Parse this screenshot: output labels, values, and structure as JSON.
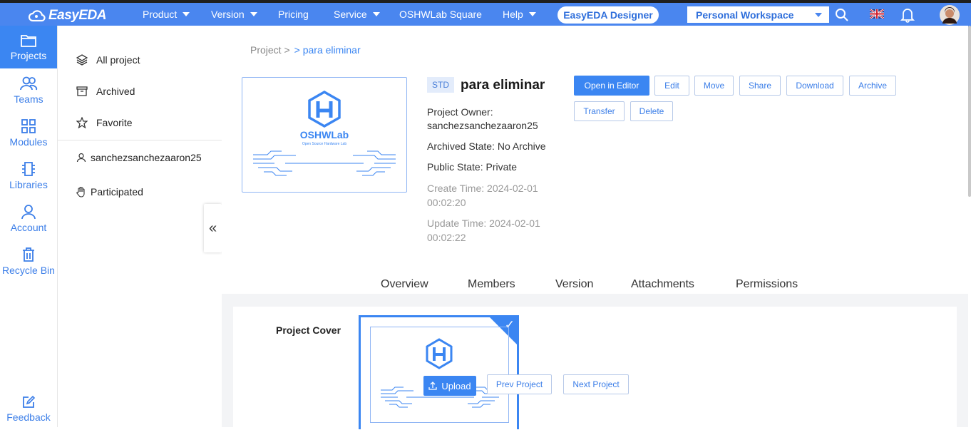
{
  "topbar": {
    "logo": "EasyEDA",
    "nav": [
      {
        "label": "Product",
        "dropdown": true
      },
      {
        "label": "Version",
        "dropdown": true
      },
      {
        "label": "Pricing",
        "dropdown": false
      },
      {
        "label": "Service",
        "dropdown": true
      },
      {
        "label": "OSHWLab Square",
        "dropdown": false
      },
      {
        "label": "Help",
        "dropdown": true
      }
    ],
    "designer_button": "EasyEDA Designer",
    "workspace": "Personal Workspace"
  },
  "leftbar": {
    "items": [
      {
        "label": "Projects",
        "icon": "folder-icon",
        "active": true
      },
      {
        "label": "Teams",
        "icon": "team-icon"
      },
      {
        "label": "Modules",
        "icon": "modules-icon"
      },
      {
        "label": "Libraries",
        "icon": "chip-icon"
      },
      {
        "label": "Account",
        "icon": "user-icon"
      },
      {
        "label": "Recycle Bin",
        "icon": "trash-icon"
      }
    ],
    "feedback": "Feedback"
  },
  "side2": {
    "items": [
      {
        "label": "All project",
        "icon": "layers-icon"
      },
      {
        "label": "Archived",
        "icon": "archive-icon"
      },
      {
        "label": "Favorite",
        "icon": "star-icon"
      }
    ],
    "user": "sanchezsanchezaaron25",
    "participated": "Participated"
  },
  "breadcrumb": {
    "root": "Project >",
    "current": "> para eliminar"
  },
  "project": {
    "badge": "STD",
    "title": "para eliminar",
    "owner_label": "Project Owner:",
    "owner": "sanchezsanchezaaron25",
    "archived_line": "Archived State:  No Archive",
    "public_line": "Public State:  Private",
    "create_line1": "Create Time:  2024-02-01",
    "create_line2": "00:02:20",
    "update_line1": "Update Time:  2024-02-01",
    "update_line2": "00:02:22",
    "logo_text": "OSHWLab",
    "logo_sub": "Open Source Hardware Lab"
  },
  "actions": {
    "open": "Open in Editor",
    "edit": "Edit",
    "move": "Move",
    "share": "Share",
    "download": "Download",
    "archive": "Archive",
    "transfer": "Transfer",
    "delete": "Delete"
  },
  "tabs": [
    "Overview",
    "Members",
    "Version",
    "Attachments",
    "Permissions"
  ],
  "cover": {
    "label": "Project Cover",
    "upload": "Upload",
    "prev": "Prev Project",
    "next": "Next Project"
  }
}
